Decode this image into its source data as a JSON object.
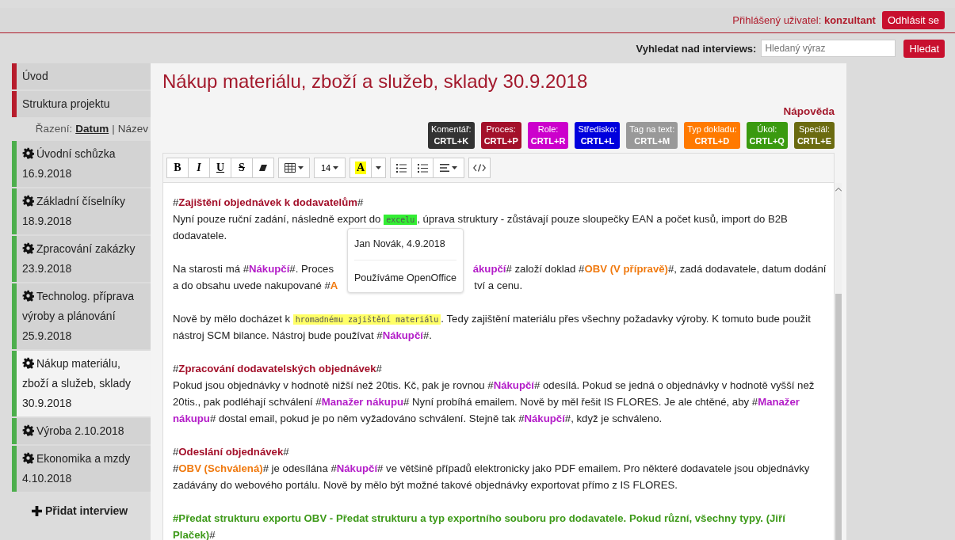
{
  "header": {
    "login_label": "Přihlášený uživatel:",
    "user": "konzultant",
    "logout": "Odhlásit se"
  },
  "search": {
    "label": "Vyhledat nad interviews:",
    "placeholder": "Hledaný výraz",
    "button": "Hledat"
  },
  "sidebar": {
    "sections": [
      {
        "label": "Úvod",
        "selected": false
      },
      {
        "label": "Struktura projektu",
        "selected": false
      }
    ],
    "sort": {
      "label": "Řazení:",
      "separator": "|",
      "options": [
        {
          "label": "Datum",
          "selected": true
        },
        {
          "label": "Název",
          "selected": false
        }
      ]
    },
    "interviews": [
      {
        "title": "Úvodní schůzka",
        "date": "16.9.2018",
        "selected": false
      },
      {
        "title": "Základní číselníky",
        "date": "18.9.2018",
        "selected": false
      },
      {
        "title": "Zpracování zakázky",
        "date": "23.9.2018",
        "selected": false
      },
      {
        "title": "Technolog. příprava výroby a plánování",
        "date": "25.9.2018",
        "selected": false
      },
      {
        "title": "Nákup materiálu, zboží a služeb, sklady",
        "date": "30.9.2018",
        "selected": true
      },
      {
        "title": "Výroba",
        "date": "2.10.2018",
        "selected": false
      },
      {
        "title": "Ekonomika a mzdy",
        "date": "4.10.2018",
        "selected": false
      }
    ],
    "add": "Přidat interview"
  },
  "page_title": "Nákup materiálu, zboží a služeb, sklady 30.9.2018",
  "help": "Nápověda",
  "shortcuts": [
    {
      "label": "Komentář:",
      "key": "CRTL+K",
      "color": "#333333"
    },
    {
      "label": "Proces:",
      "key": "CRTL+P",
      "color": "#a3102a"
    },
    {
      "label": "Role:",
      "key": "CRTL+R",
      "color": "#cc00cc"
    },
    {
      "label": "Středisko:",
      "key": "CRTL+L",
      "color": "#0000dd"
    },
    {
      "label": "Tag na text:",
      "key": "CRTL+M",
      "color": "#999999"
    },
    {
      "label": "Typ dokladu:",
      "key": "CRTL+D",
      "color": "#ff7a00"
    },
    {
      "label": "Úkol:",
      "key": "CRTL+Q",
      "color": "#3a9a10"
    },
    {
      "label": "Speciál:",
      "key": "CRTL+E",
      "color": "#6b6b10"
    }
  ],
  "toolbar": {
    "bold": "B",
    "italic": "I",
    "underline": "U",
    "strike": "S",
    "font_size": "14",
    "highlight": "A"
  },
  "paragraphs": [
    [
      [
        {
          "kind": "text",
          "text": "#"
        },
        {
          "kind": "proces",
          "text": "Zajištění objednávek k dodavatelům"
        },
        {
          "kind": "text",
          "text": "#"
        }
      ],
      [
        {
          "kind": "text",
          "text": "Nyní pouze ruční zadání, následně export do "
        },
        {
          "kind": "code",
          "text": "excelu",
          "color": "#33ee33"
        },
        {
          "kind": "text",
          "text": ", úprava struktury - zůstávají pouze sloupečky EAN a počet kusů, import do B2B"
        }
      ],
      [
        {
          "kind": "text",
          "text": "dodavatele."
        }
      ]
    ],
    [
      [
        {
          "kind": "text",
          "text": "Na starosti má #"
        },
        {
          "kind": "role",
          "text": "Nákupčí"
        },
        {
          "kind": "text",
          "text": "#. Proces "
        },
        {
          "kind": "gap"
        },
        {
          "kind": "role",
          "text": "ákupčí"
        },
        {
          "kind": "text",
          "text": "# založí doklad #"
        },
        {
          "kind": "doklad",
          "text": "OBV (V přípravě)"
        },
        {
          "kind": "text",
          "text": "#, zadá dodavatele, datum dodání"
        }
      ],
      [
        {
          "kind": "text",
          "text": "a do obsahu uvede nakupované #"
        },
        {
          "kind": "doklad",
          "text": "A"
        },
        {
          "kind": "gap"
        },
        {
          "kind": "text",
          "text": "tví a cenu."
        }
      ]
    ],
    [
      [
        {
          "kind": "text",
          "text": "Nově by mělo docházet k "
        },
        {
          "kind": "code",
          "text": "hromadnému zajištění materiálu",
          "color": "#ffff66"
        },
        {
          "kind": "text",
          "text": ". Tedy zajištění materiálu přes všechny požadavky výroby. K tomuto bude použit"
        }
      ],
      [
        {
          "kind": "text",
          "text": "nástroj SCM bilance. Nástroj bude používat #"
        },
        {
          "kind": "role",
          "text": "Nákupčí"
        },
        {
          "kind": "text",
          "text": "#."
        }
      ]
    ],
    [
      [
        {
          "kind": "text",
          "text": "#"
        },
        {
          "kind": "proces",
          "text": "Zpracování dodavatelských objednávek"
        },
        {
          "kind": "text",
          "text": "#"
        }
      ],
      [
        {
          "kind": "text",
          "text": "Pokud jsou objednávky v hodnotě nižší než 20tis. Kč, pak je rovnou #"
        },
        {
          "kind": "role",
          "text": "Nákupčí"
        },
        {
          "kind": "text",
          "text": "# odesílá. Pokud se jedná o objednávky v hodnotě vyšší než"
        }
      ],
      [
        {
          "kind": "text",
          "text": "20tis., pak podléhají schválení #"
        },
        {
          "kind": "role",
          "text": "Manažer nákupu"
        },
        {
          "kind": "text",
          "text": "# Nyní probíhá emailem. Nově by měl řešit IS FLORES. Je ale chtěné, aby #"
        },
        {
          "kind": "role",
          "text": "Manažer"
        }
      ],
      [
        {
          "kind": "role",
          "text": "nákupu"
        },
        {
          "kind": "text",
          "text": "# dostal email, pokud je po něm vyžadováno schválení. Stejně tak #"
        },
        {
          "kind": "role",
          "text": "Nákupčí"
        },
        {
          "kind": "text",
          "text": "#, když je schváleno."
        }
      ]
    ],
    [
      [
        {
          "kind": "text",
          "text": "#"
        },
        {
          "kind": "proces",
          "text": "Odeslání objednávek"
        },
        {
          "kind": "text",
          "text": "#"
        }
      ],
      [
        {
          "kind": "text",
          "text": "#"
        },
        {
          "kind": "doklad",
          "text": "OBV (Schválená)"
        },
        {
          "kind": "text",
          "text": "# je odesílána #"
        },
        {
          "kind": "role",
          "text": "Nákupčí"
        },
        {
          "kind": "text",
          "text": "# ve většině případů elektronicky jako PDF emailem. Pro některé dodavatele jsou objednávky"
        }
      ],
      [
        {
          "kind": "text",
          "text": "zadávány do webového portálu. Nově by mělo být možné takové objednávky exportovat přímo z IS FLORES."
        }
      ]
    ],
    [
      [
        {
          "kind": "special",
          "text": "#Předat strukturu exportu OBV - Předat strukturu a typ exportního souboru pro dodavatele. Pokud různí, všechny typy. (Jiří"
        }
      ],
      [
        {
          "kind": "special",
          "text": "Plaček)"
        },
        {
          "kind": "text",
          "text": "#"
        }
      ]
    ]
  ],
  "popup": {
    "author": "Jan Novák, 4.9.2018",
    "text": "Používáme OpenOffice"
  }
}
